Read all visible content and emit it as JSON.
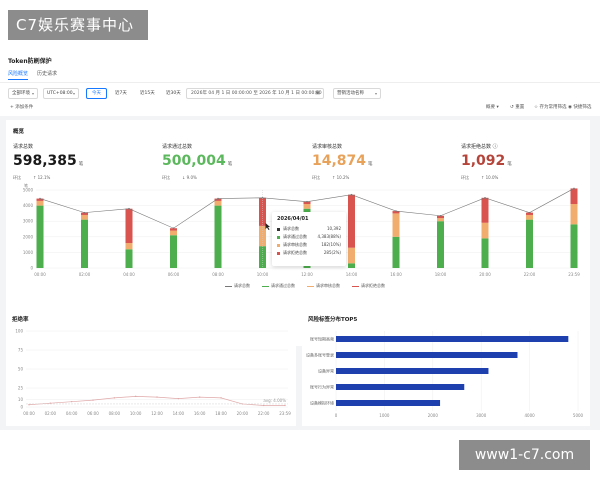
{
  "watermark": {
    "top": "C7娱乐赛事中心",
    "bottom": "www1-c7.com"
  },
  "page": {
    "title": "Token防刷保护",
    "tabs": [
      {
        "label": "风险概览",
        "active": true
      },
      {
        "label": "历史请求",
        "active": false
      }
    ]
  },
  "filters": {
    "env": "全部环境",
    "timezone": "UTC+08:00",
    "quick_ranges": [
      "今天",
      "近7天",
      "近15天",
      "近30天"
    ],
    "active_range": "今天",
    "date_range": "2026年 04 月 1 日 00:00:00 至 2026 年 10 月 1 日 00:00:00",
    "activity": "营销活动名称",
    "add_condition": "添加条件",
    "view": "概要",
    "reset": "重置",
    "save_filter": "存为常用筛选",
    "quick_filter": "快捷筛选"
  },
  "overview": {
    "title": "概览",
    "kpis": [
      {
        "label": "请求总数",
        "value": "598,385",
        "unit": "笔",
        "sub_label": "环比",
        "delta": "↑ 12.1%",
        "color": "#1a1a1a"
      },
      {
        "label": "请求通过总数",
        "value": "500,004",
        "unit": "笔",
        "sub_label": "环比",
        "delta": "↓ 9.0%",
        "color": "#5cb85c"
      },
      {
        "label": "请求审核总数",
        "value": "14,874",
        "unit": "笔",
        "sub_label": "环比",
        "delta": "↑ 10.2%",
        "color": "#e8a25a"
      },
      {
        "label": "请求拒绝总数",
        "value": "1,092",
        "unit": "笔",
        "sub_label": "环比",
        "delta": "↑ 10.0%",
        "color": "#b5453b"
      }
    ]
  },
  "tooltip": {
    "title": "2026/04/01",
    "rows": [
      {
        "label": "请求总数",
        "value": "10,392",
        "color": "#333333"
      },
      {
        "label": "请求通过总数",
        "value": "4,383(88%)",
        "color": "#4cae4c"
      },
      {
        "label": "请求审核总数",
        "value": "182(10%)",
        "color": "#f0ad6e"
      },
      {
        "label": "请求拒绝总数",
        "value": "285(2%)",
        "color": "#d9534f"
      }
    ]
  },
  "main_chart_legend": [
    "请求总数",
    "请求通过总数",
    "请求审核总数",
    "请求拒绝总数"
  ],
  "chart_data": [
    {
      "type": "bar",
      "stacked": true,
      "title": "",
      "ylabel": "笔",
      "ylim": [
        0,
        5000
      ],
      "yticks": [
        0,
        1000,
        2000,
        3000,
        4000,
        5000
      ],
      "categories": [
        "00:00",
        "02:00",
        "04:00",
        "06:00",
        "08:00",
        "10:00",
        "12:00",
        "14:00",
        "16:00",
        "18:00",
        "20:00",
        "22:00",
        "23:59"
      ],
      "series": [
        {
          "name": "请求通过总数",
          "color": "#4cae4c",
          "values": [
            4000,
            3100,
            1200,
            2100,
            4000,
            1400,
            3800,
            300,
            2000,
            3000,
            1900,
            3100,
            2800
          ]
        },
        {
          "name": "请求审核总数",
          "color": "#f0ad6e",
          "values": [
            300,
            300,
            400,
            300,
            300,
            1300,
            300,
            1000,
            1500,
            200,
            1000,
            300,
            1300
          ]
        },
        {
          "name": "请求拒绝总数",
          "color": "#d9534f",
          "values": [
            150,
            150,
            2200,
            150,
            150,
            1800,
            150,
            3400,
            150,
            150,
            1600,
            150,
            1000
          ]
        }
      ],
      "line": {
        "name": "请求总数",
        "color": "#777777",
        "values": [
          4450,
          3550,
          3800,
          2550,
          4450,
          4500,
          4250,
          4700,
          3650,
          3350,
          4500,
          3550,
          5100
        ]
      },
      "legend": "bottom",
      "grid": true
    },
    {
      "type": "line",
      "title": "拒绝率",
      "ylim": [
        0,
        100
      ],
      "yticks": [
        0,
        10,
        25,
        50,
        75,
        100
      ],
      "ytick_labels": [
        "0",
        "10",
        "25",
        "50",
        "75",
        "100"
      ],
      "categories": [
        "00:00",
        "02:00",
        "04:00",
        "06:00",
        "08:00",
        "10:00",
        "12:00",
        "14:00",
        "16:00",
        "18:00",
        "20:00",
        "22:00",
        "23:59"
      ],
      "series": [
        {
          "name": "拒绝率",
          "color": "#e0a8a8",
          "values": [
            3,
            5,
            7,
            9,
            12,
            14,
            13,
            11,
            13,
            12,
            4,
            2,
            2
          ]
        }
      ],
      "annotation": "avg: 4.00%",
      "grid": true
    },
    {
      "type": "bar",
      "orientation": "horizontal",
      "title": "风险标签分布TOP5",
      "categories": [
        "账号短期高频",
        "设备多账号登录",
        "设备异常",
        "账号行为异常",
        "设备模拟环境"
      ],
      "values": [
        4800,
        3750,
        3150,
        2650,
        2150
      ],
      "xlim": [
        0,
        5000
      ],
      "xticks": [
        0,
        1000,
        2000,
        3000,
        4000,
        5000
      ],
      "color": "#1e40af",
      "grid": true
    }
  ]
}
